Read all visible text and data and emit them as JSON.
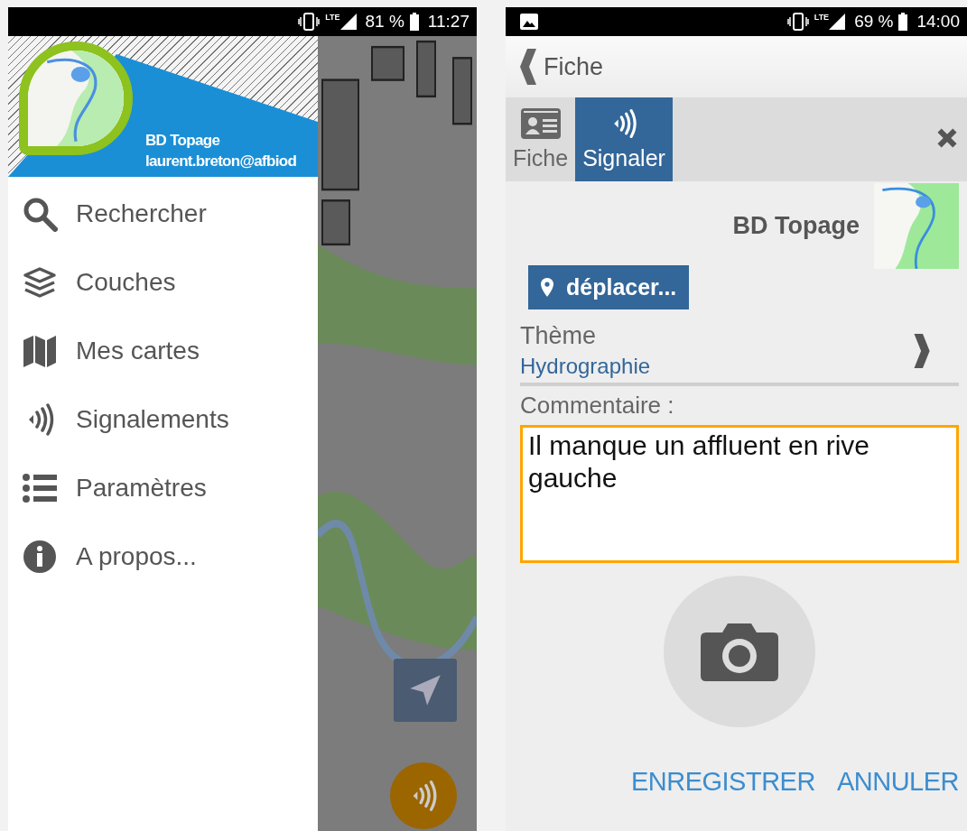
{
  "left_screen": {
    "status_bar": {
      "network": "LTE",
      "battery": "81 %",
      "time": "11:27"
    },
    "drawer": {
      "title": "BD Topage",
      "email": "laurent.breton@afbiod",
      "items": [
        {
          "label": "Rechercher"
        },
        {
          "label": "Couches"
        },
        {
          "label": "Mes cartes"
        },
        {
          "label": "Signalements"
        },
        {
          "label": "Paramètres"
        },
        {
          "label": "A propos..."
        }
      ]
    }
  },
  "right_screen": {
    "status_bar": {
      "network": "LTE",
      "battery": "69 %",
      "time": "14:00"
    },
    "header": {
      "back_label": "Fiche"
    },
    "tabs": [
      {
        "label": "Fiche",
        "selected": false
      },
      {
        "label": "Signaler",
        "selected": true
      }
    ],
    "layer_name": "BD Topage",
    "move_button": "déplacer...",
    "theme": {
      "label": "Thème",
      "value": "Hydrographie"
    },
    "comment": {
      "label": "Commentaire :",
      "value": "Il manque un affluent en rive gauche"
    },
    "buttons": [
      "ENREGISTRER",
      "ANNULER"
    ]
  }
}
